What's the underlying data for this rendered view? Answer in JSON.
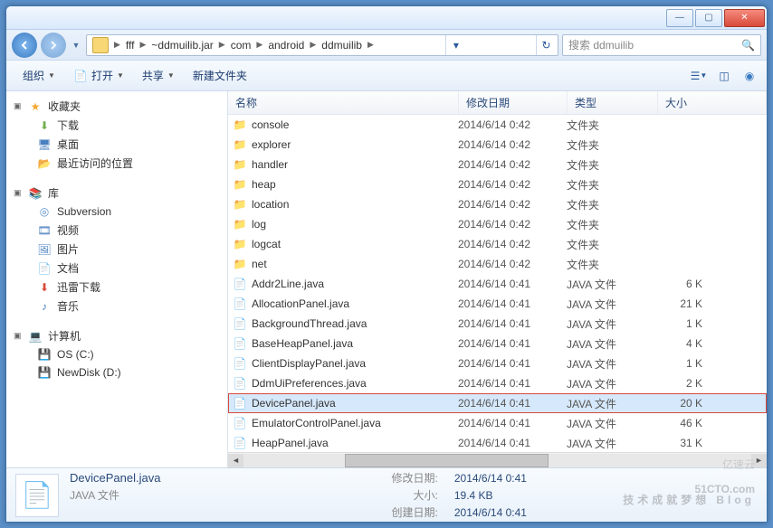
{
  "titlebar": {
    "min": "—",
    "max": "▢",
    "close": "✕"
  },
  "breadcrumb": [
    "fff",
    "~ddmuilib.jar",
    "com",
    "android",
    "ddmuilib"
  ],
  "search_placeholder": "搜索 ddmuilib",
  "toolbar": {
    "organize": "组织",
    "open": "打开",
    "share": "共享",
    "newfolder": "新建文件夹"
  },
  "columns": {
    "name": "名称",
    "date": "修改日期",
    "type": "类型",
    "size": "大小"
  },
  "sidebar": {
    "fav": {
      "label": "收藏夹",
      "items": [
        "下载",
        "桌面",
        "最近访问的位置"
      ]
    },
    "lib": {
      "label": "库",
      "items": [
        "Subversion",
        "视频",
        "图片",
        "文档",
        "迅雷下载",
        "音乐"
      ]
    },
    "comp": {
      "label": "计算机",
      "items": [
        "OS (C:)",
        "NewDisk (D:)"
      ]
    }
  },
  "files": [
    {
      "name": "console",
      "date": "2014/6/14 0:42",
      "type": "文件夹",
      "size": "",
      "kind": "folder"
    },
    {
      "name": "explorer",
      "date": "2014/6/14 0:42",
      "type": "文件夹",
      "size": "",
      "kind": "folder"
    },
    {
      "name": "handler",
      "date": "2014/6/14 0:42",
      "type": "文件夹",
      "size": "",
      "kind": "folder"
    },
    {
      "name": "heap",
      "date": "2014/6/14 0:42",
      "type": "文件夹",
      "size": "",
      "kind": "folder"
    },
    {
      "name": "location",
      "date": "2014/6/14 0:42",
      "type": "文件夹",
      "size": "",
      "kind": "folder"
    },
    {
      "name": "log",
      "date": "2014/6/14 0:42",
      "type": "文件夹",
      "size": "",
      "kind": "folder"
    },
    {
      "name": "logcat",
      "date": "2014/6/14 0:42",
      "type": "文件夹",
      "size": "",
      "kind": "folder"
    },
    {
      "name": "net",
      "date": "2014/6/14 0:42",
      "type": "文件夹",
      "size": "",
      "kind": "folder"
    },
    {
      "name": "Addr2Line.java",
      "date": "2014/6/14 0:41",
      "type": "JAVA 文件",
      "size": "6 K",
      "kind": "file"
    },
    {
      "name": "AllocationPanel.java",
      "date": "2014/6/14 0:41",
      "type": "JAVA 文件",
      "size": "21 K",
      "kind": "file"
    },
    {
      "name": "BackgroundThread.java",
      "date": "2014/6/14 0:41",
      "type": "JAVA 文件",
      "size": "1 K",
      "kind": "file"
    },
    {
      "name": "BaseHeapPanel.java",
      "date": "2014/6/14 0:41",
      "type": "JAVA 文件",
      "size": "4 K",
      "kind": "file"
    },
    {
      "name": "ClientDisplayPanel.java",
      "date": "2014/6/14 0:41",
      "type": "JAVA 文件",
      "size": "1 K",
      "kind": "file"
    },
    {
      "name": "DdmUiPreferences.java",
      "date": "2014/6/14 0:41",
      "type": "JAVA 文件",
      "size": "2 K",
      "kind": "file"
    },
    {
      "name": "DevicePanel.java",
      "date": "2014/6/14 0:41",
      "type": "JAVA 文件",
      "size": "20 K",
      "kind": "file",
      "sel": true
    },
    {
      "name": "EmulatorControlPanel.java",
      "date": "2014/6/14 0:41",
      "type": "JAVA 文件",
      "size": "46 K",
      "kind": "file"
    },
    {
      "name": "HeapPanel.java",
      "date": "2014/6/14 0:41",
      "type": "JAVA 文件",
      "size": "31 K",
      "kind": "file"
    }
  ],
  "details": {
    "filename": "DevicePanel.java",
    "filetype": "JAVA 文件",
    "mod_lbl": "修改日期:",
    "mod_val": "2014/6/14 0:41",
    "size_lbl": "大小:",
    "size_val": "19.4 KB",
    "created_lbl": "创建日期:",
    "created_val": "2014/6/14 0:41"
  },
  "watermark": {
    "main": "51CTO.com",
    "sub": "技术成就梦想",
    "tag": "Blog"
  },
  "watermark2": "亿速云"
}
